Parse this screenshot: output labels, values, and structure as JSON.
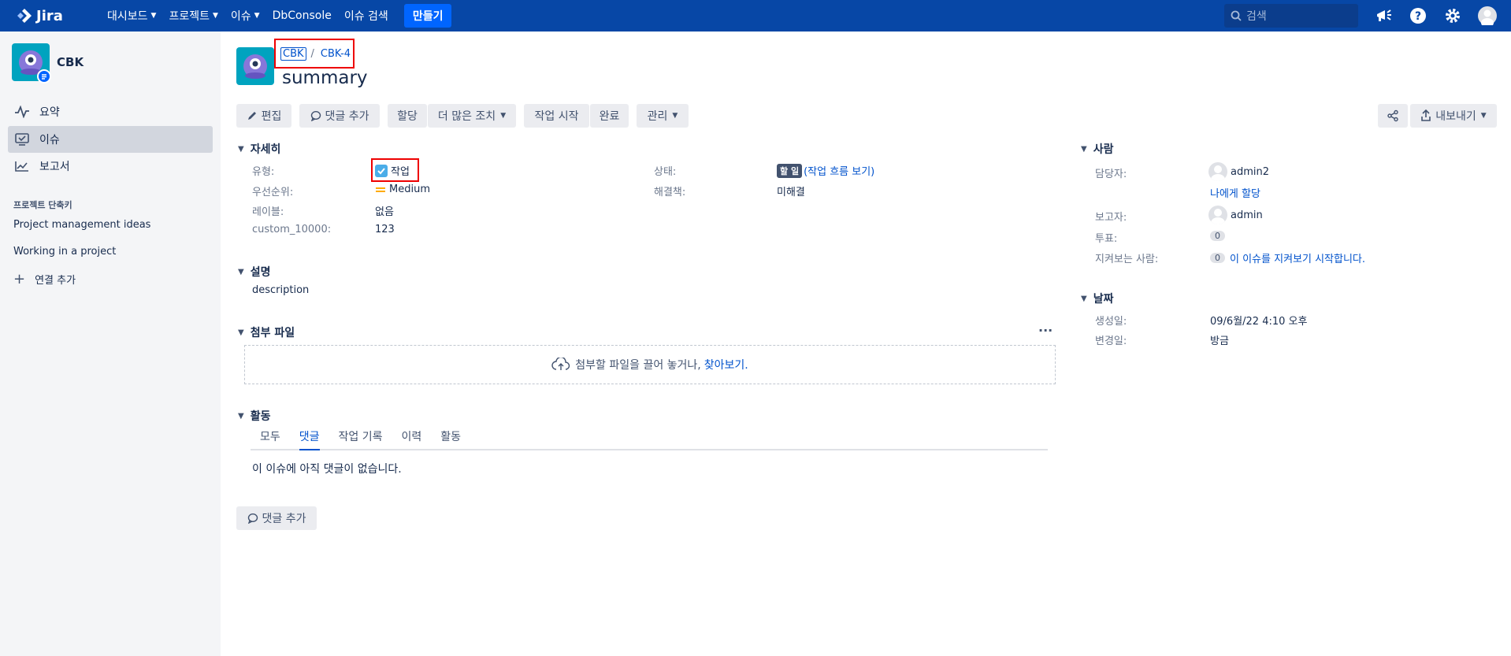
{
  "topnav": {
    "logo_text": "Jira",
    "menu": [
      {
        "label": "대시보드",
        "dropdown": true
      },
      {
        "label": "프로젝트",
        "dropdown": true
      },
      {
        "label": "이슈",
        "dropdown": true
      },
      {
        "label": "DbConsole",
        "dropdown": false
      },
      {
        "label": "이슈 검색",
        "dropdown": false
      }
    ],
    "create_label": "만들기",
    "search_placeholder": "검색",
    "icons": [
      "megaphone-icon",
      "help-icon",
      "settings-icon",
      "user-avatar-icon"
    ]
  },
  "sidebar": {
    "project_name": "CBK",
    "items": [
      {
        "label": "요약",
        "icon": "activity-icon",
        "active": false
      },
      {
        "label": "이슈",
        "icon": "issues-icon",
        "active": true
      },
      {
        "label": "보고서",
        "icon": "chart-icon",
        "active": false
      }
    ],
    "shortcuts_title": "프로젝트 단축키",
    "shortcuts": [
      "Project management ideas",
      "Working in a project"
    ],
    "add_link_label": "연결 추가"
  },
  "issue": {
    "breadcrumb_project": "CBK",
    "breadcrumb_sep": "/",
    "breadcrumb_key": "CBK-4",
    "summary": "summary"
  },
  "toolbar": {
    "edit": "편집",
    "comment": "댓글 추가",
    "assign": "할당",
    "more": "더 많은 조치",
    "start": "작업 시작",
    "done": "완료",
    "admin": "관리",
    "export": "내보내기"
  },
  "details": {
    "title": "자세히",
    "type_label": "유형:",
    "type_value": "작업",
    "priority_label": "우선순위:",
    "priority_value": "Medium",
    "labels_label": "레이블:",
    "labels_value": "없음",
    "custom_label": "custom_10000:",
    "custom_value": "123",
    "status_label": "상태:",
    "status_value": "할 일",
    "workflow_link": "(작업 흐름 보기)",
    "resolution_label": "해결책:",
    "resolution_value": "미해결"
  },
  "description": {
    "title": "설명",
    "text": "description"
  },
  "attachments": {
    "title": "첨부 파일",
    "drop_text": "첨부할 파일을 끌어 놓거나,",
    "browse_link": "찾아보기."
  },
  "activity": {
    "title": "활동",
    "tabs": [
      "모두",
      "댓글",
      "작업 기록",
      "이력",
      "활동"
    ],
    "active_tab": "댓글",
    "empty_text": "이 이슈에 아직 댓글이 없습니다.",
    "add_comment": "댓글 추가"
  },
  "people": {
    "title": "사람",
    "assignee_label": "담당자:",
    "assignee": "admin2",
    "assign_me": "나에게 할당",
    "reporter_label": "보고자:",
    "reporter": "admin",
    "votes_label": "투표:",
    "votes": "0",
    "watchers_label": "지켜보는 사람:",
    "watchers": "0",
    "watch_link": "이 이슈를 지켜보기 시작합니다."
  },
  "dates": {
    "title": "날짜",
    "created_label": "생성일:",
    "created": "09/6월/22 4:10 오후",
    "updated_label": "변경일:",
    "updated": "방금"
  },
  "colors": {
    "nav": "#0747a6",
    "accent": "#0052cc",
    "highlight": "#e00000"
  }
}
